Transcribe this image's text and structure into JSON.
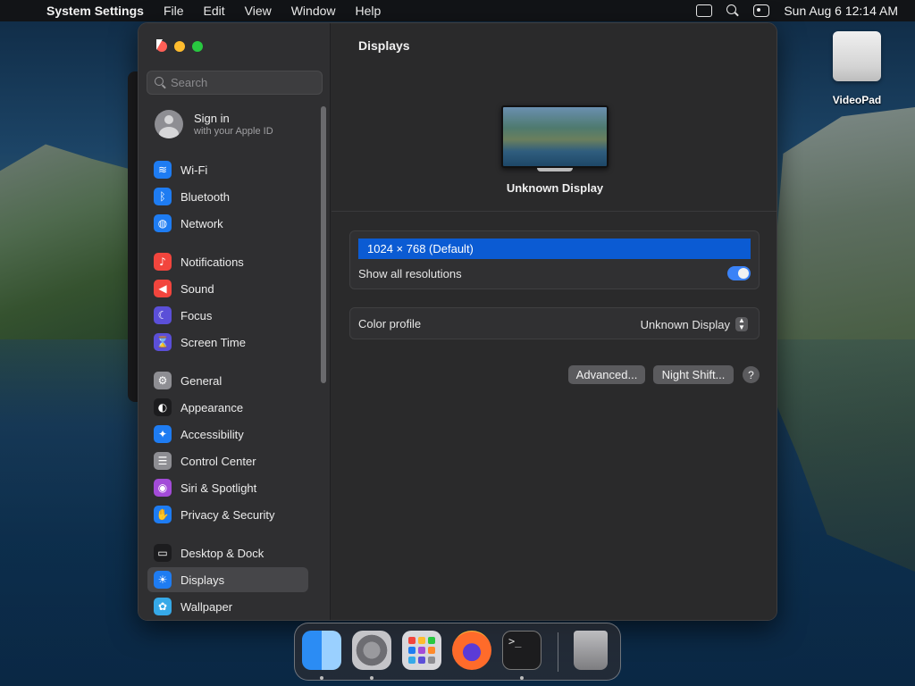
{
  "menubar": {
    "apple_icon": "apple-logo-icon",
    "app_name": "System Settings",
    "menus": [
      "File",
      "Edit",
      "View",
      "Window",
      "Help"
    ],
    "clock": "Sun Aug 6  12:14 AM"
  },
  "desktop": {
    "icon_label": "VideoPad"
  },
  "window": {
    "search_placeholder": "Search",
    "signin": {
      "title": "Sign in",
      "subtitle": "with your Apple ID"
    },
    "sidebar": [
      {
        "label": "Wi-Fi",
        "icon": "wifi-icon",
        "color": "#1e7cf2",
        "glyph": "≋"
      },
      {
        "label": "Bluetooth",
        "icon": "bluetooth-icon",
        "color": "#1e7cf2",
        "glyph": "ᛒ"
      },
      {
        "label": "Network",
        "icon": "globe-icon",
        "color": "#1e7cf2",
        "glyph": "◍"
      },
      {
        "label": "Notifications",
        "icon": "bell-icon",
        "color": "#f2453d",
        "glyph": "♪"
      },
      {
        "label": "Sound",
        "icon": "speaker-icon",
        "color": "#f2453d",
        "glyph": "◀"
      },
      {
        "label": "Focus",
        "icon": "moon-icon",
        "color": "#5b4fd8",
        "glyph": "☾"
      },
      {
        "label": "Screen Time",
        "icon": "hourglass-icon",
        "color": "#5b4fd8",
        "glyph": "⌛"
      },
      {
        "label": "General",
        "icon": "gear-icon",
        "color": "#8e8e93",
        "glyph": "⚙"
      },
      {
        "label": "Appearance",
        "icon": "appearance-icon",
        "color": "#1c1c1e",
        "glyph": "◐"
      },
      {
        "label": "Accessibility",
        "icon": "accessibility-icon",
        "color": "#1e7cf2",
        "glyph": "✦"
      },
      {
        "label": "Control Center",
        "icon": "toggles-icon",
        "color": "#8e8e93",
        "glyph": "☰"
      },
      {
        "label": "Siri & Spotlight",
        "icon": "siri-icon",
        "color": "#a34bd8",
        "glyph": "◉"
      },
      {
        "label": "Privacy & Security",
        "icon": "hand-icon",
        "color": "#1e7cf2",
        "glyph": "✋"
      },
      {
        "label": "Desktop & Dock",
        "icon": "dock-icon",
        "color": "#1c1c1e",
        "glyph": "▭"
      },
      {
        "label": "Displays",
        "icon": "sun-icon",
        "color": "#1e7cf2",
        "glyph": "☀"
      },
      {
        "label": "Wallpaper",
        "icon": "wallpaper-icon",
        "color": "#36a9e8",
        "glyph": "✿"
      }
    ],
    "selected": "Displays"
  },
  "content": {
    "title": "Displays",
    "display_name": "Unknown Display",
    "resolution": "1024 × 768 (Default)",
    "show_all_label": "Show all resolutions",
    "show_all_on": true,
    "color_profile_label": "Color profile",
    "color_profile_value": "Unknown Display",
    "advanced_button": "Advanced...",
    "night_shift_button": "Night Shift...",
    "help_button": "?"
  },
  "dock": {
    "apps": [
      "Finder",
      "System Settings",
      "Launchpad",
      "Firefox",
      "Terminal",
      "Trash"
    ],
    "terminal_prompt": ">_"
  }
}
